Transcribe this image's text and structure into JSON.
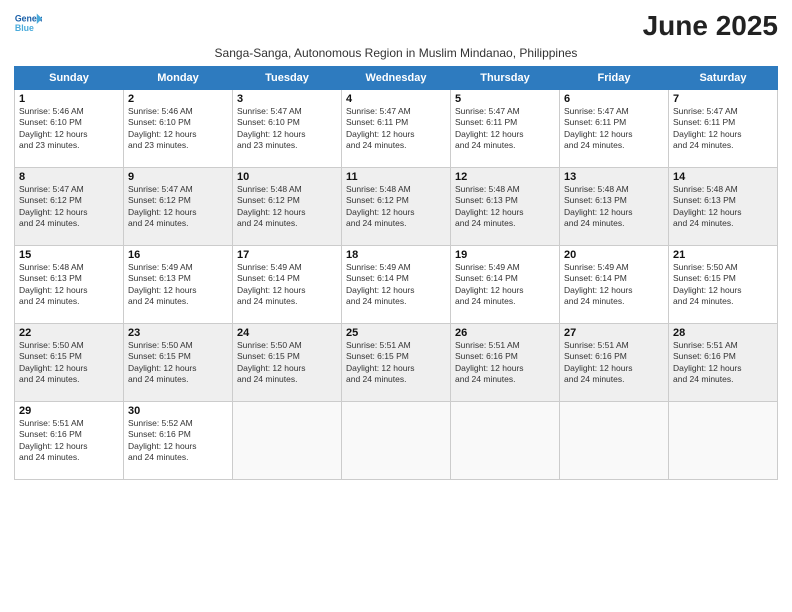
{
  "header": {
    "logo_line1": "General",
    "logo_line2": "Blue",
    "month_title": "June 2025",
    "subtitle": "Sanga-Sanga, Autonomous Region in Muslim Mindanao, Philippines"
  },
  "days_of_week": [
    "Sunday",
    "Monday",
    "Tuesday",
    "Wednesday",
    "Thursday",
    "Friday",
    "Saturday"
  ],
  "weeks": [
    [
      {
        "day": 1,
        "sunrise": "5:46 AM",
        "sunset": "6:10 PM",
        "daylight": "12 hours and 23 minutes."
      },
      {
        "day": 2,
        "sunrise": "5:46 AM",
        "sunset": "6:10 PM",
        "daylight": "12 hours and 23 minutes."
      },
      {
        "day": 3,
        "sunrise": "5:47 AM",
        "sunset": "6:10 PM",
        "daylight": "12 hours and 23 minutes."
      },
      {
        "day": 4,
        "sunrise": "5:47 AM",
        "sunset": "6:11 PM",
        "daylight": "12 hours and 24 minutes."
      },
      {
        "day": 5,
        "sunrise": "5:47 AM",
        "sunset": "6:11 PM",
        "daylight": "12 hours and 24 minutes."
      },
      {
        "day": 6,
        "sunrise": "5:47 AM",
        "sunset": "6:11 PM",
        "daylight": "12 hours and 24 minutes."
      },
      {
        "day": 7,
        "sunrise": "5:47 AM",
        "sunset": "6:11 PM",
        "daylight": "12 hours and 24 minutes."
      }
    ],
    [
      {
        "day": 8,
        "sunrise": "5:47 AM",
        "sunset": "6:12 PM",
        "daylight": "12 hours and 24 minutes."
      },
      {
        "day": 9,
        "sunrise": "5:47 AM",
        "sunset": "6:12 PM",
        "daylight": "12 hours and 24 minutes."
      },
      {
        "day": 10,
        "sunrise": "5:48 AM",
        "sunset": "6:12 PM",
        "daylight": "12 hours and 24 minutes."
      },
      {
        "day": 11,
        "sunrise": "5:48 AM",
        "sunset": "6:12 PM",
        "daylight": "12 hours and 24 minutes."
      },
      {
        "day": 12,
        "sunrise": "5:48 AM",
        "sunset": "6:13 PM",
        "daylight": "12 hours and 24 minutes."
      },
      {
        "day": 13,
        "sunrise": "5:48 AM",
        "sunset": "6:13 PM",
        "daylight": "12 hours and 24 minutes."
      },
      {
        "day": 14,
        "sunrise": "5:48 AM",
        "sunset": "6:13 PM",
        "daylight": "12 hours and 24 minutes."
      }
    ],
    [
      {
        "day": 15,
        "sunrise": "5:48 AM",
        "sunset": "6:13 PM",
        "daylight": "12 hours and 24 minutes."
      },
      {
        "day": 16,
        "sunrise": "5:49 AM",
        "sunset": "6:13 PM",
        "daylight": "12 hours and 24 minutes."
      },
      {
        "day": 17,
        "sunrise": "5:49 AM",
        "sunset": "6:14 PM",
        "daylight": "12 hours and 24 minutes."
      },
      {
        "day": 18,
        "sunrise": "5:49 AM",
        "sunset": "6:14 PM",
        "daylight": "12 hours and 24 minutes."
      },
      {
        "day": 19,
        "sunrise": "5:49 AM",
        "sunset": "6:14 PM",
        "daylight": "12 hours and 24 minutes."
      },
      {
        "day": 20,
        "sunrise": "5:49 AM",
        "sunset": "6:14 PM",
        "daylight": "12 hours and 24 minutes."
      },
      {
        "day": 21,
        "sunrise": "5:50 AM",
        "sunset": "6:15 PM",
        "daylight": "12 hours and 24 minutes."
      }
    ],
    [
      {
        "day": 22,
        "sunrise": "5:50 AM",
        "sunset": "6:15 PM",
        "daylight": "12 hours and 24 minutes."
      },
      {
        "day": 23,
        "sunrise": "5:50 AM",
        "sunset": "6:15 PM",
        "daylight": "12 hours and 24 minutes."
      },
      {
        "day": 24,
        "sunrise": "5:50 AM",
        "sunset": "6:15 PM",
        "daylight": "12 hours and 24 minutes."
      },
      {
        "day": 25,
        "sunrise": "5:51 AM",
        "sunset": "6:15 PM",
        "daylight": "12 hours and 24 minutes."
      },
      {
        "day": 26,
        "sunrise": "5:51 AM",
        "sunset": "6:16 PM",
        "daylight": "12 hours and 24 minutes."
      },
      {
        "day": 27,
        "sunrise": "5:51 AM",
        "sunset": "6:16 PM",
        "daylight": "12 hours and 24 minutes."
      },
      {
        "day": 28,
        "sunrise": "5:51 AM",
        "sunset": "6:16 PM",
        "daylight": "12 hours and 24 minutes."
      }
    ],
    [
      {
        "day": 29,
        "sunrise": "5:51 AM",
        "sunset": "6:16 PM",
        "daylight": "12 hours and 24 minutes."
      },
      {
        "day": 30,
        "sunrise": "5:52 AM",
        "sunset": "6:16 PM",
        "daylight": "12 hours and 24 minutes."
      },
      null,
      null,
      null,
      null,
      null
    ]
  ]
}
